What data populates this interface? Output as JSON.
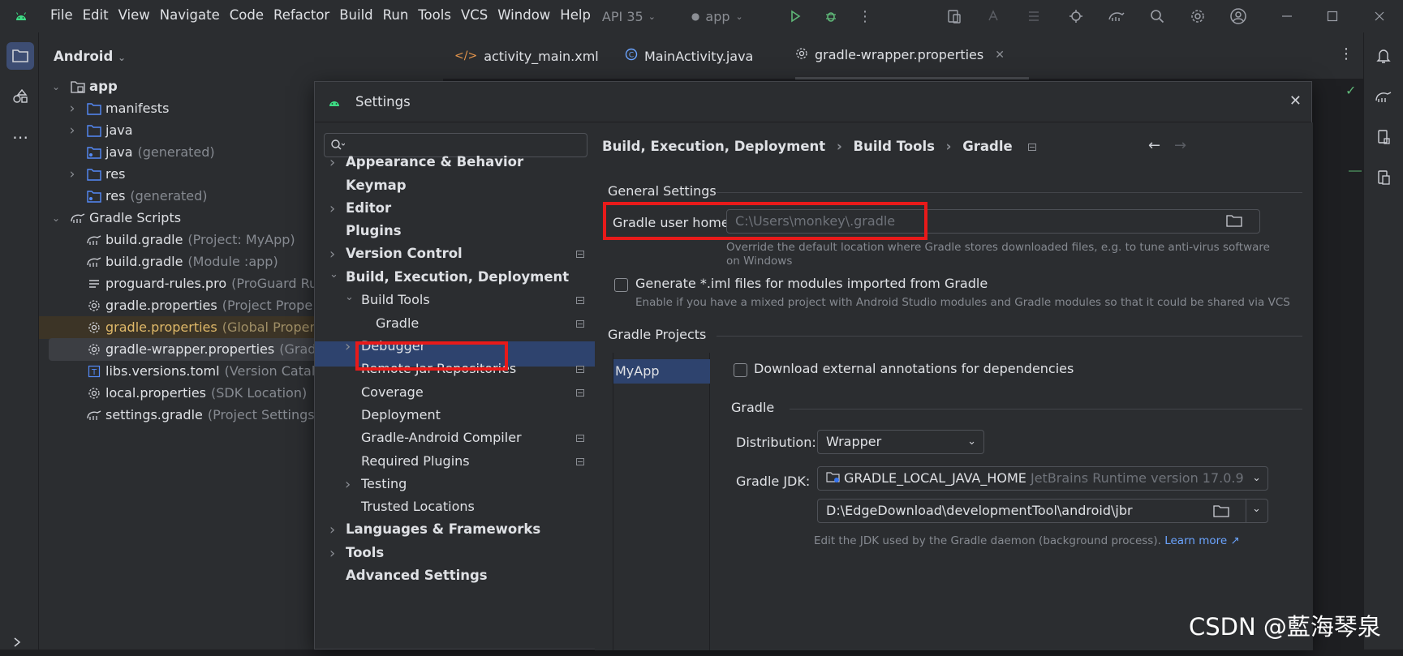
{
  "menu": [
    {
      "label": "File"
    },
    {
      "label": "Edit"
    },
    {
      "label": "View"
    },
    {
      "label": "Navigate"
    },
    {
      "label": "Code"
    },
    {
      "label": "Refactor"
    },
    {
      "label": "Build"
    },
    {
      "label": "Run"
    },
    {
      "label": "Tools"
    },
    {
      "label": "VCS"
    },
    {
      "label": "Window"
    },
    {
      "label": "Help"
    }
  ],
  "api_level": "API 35",
  "run_config": "app",
  "project_panel": {
    "title": "Android",
    "tree": [
      {
        "label": "app",
        "hint": ""
      },
      {
        "label": "manifests",
        "hint": ""
      },
      {
        "label": "java",
        "hint": ""
      },
      {
        "label": "java",
        "hint": "(generated)"
      },
      {
        "label": "res",
        "hint": ""
      },
      {
        "label": "res",
        "hint": "(generated)"
      },
      {
        "label": "Gradle Scripts",
        "hint": ""
      },
      {
        "label": "build.gradle",
        "hint": "(Project: MyApp)"
      },
      {
        "label": "build.gradle",
        "hint": "(Module :app)"
      },
      {
        "label": "proguard-rules.pro",
        "hint": "(ProGuard Ru"
      },
      {
        "label": "gradle.properties",
        "hint": "(Project Prope"
      },
      {
        "label": "gradle.properties",
        "hint": "(Global Proper"
      },
      {
        "label": "gradle-wrapper.properties",
        "hint": "(Grad"
      },
      {
        "label": "libs.versions.toml",
        "hint": "(Version Catal"
      },
      {
        "label": "local.properties",
        "hint": "(SDK Location)"
      },
      {
        "label": "settings.gradle",
        "hint": "(Project Settings"
      }
    ]
  },
  "tabs": [
    {
      "label": "activity_main.xml"
    },
    {
      "label": "MainActivity.java"
    },
    {
      "label": "gradle-wrapper.properties"
    }
  ],
  "settings": {
    "title": "Settings",
    "search_placeholder": "",
    "nav": [
      {
        "label": "Appearance & Behavior"
      },
      {
        "label": "Keymap"
      },
      {
        "label": "Editor"
      },
      {
        "label": "Plugins"
      },
      {
        "label": "Version Control"
      },
      {
        "label": "Build, Execution, Deployment"
      },
      {
        "label": "Build Tools"
      },
      {
        "label": "Gradle"
      },
      {
        "label": "Debugger"
      },
      {
        "label": "Remote Jar Repositories"
      },
      {
        "label": "Coverage"
      },
      {
        "label": "Deployment"
      },
      {
        "label": "Gradle-Android Compiler"
      },
      {
        "label": "Required Plugins"
      },
      {
        "label": "Testing"
      },
      {
        "label": "Trusted Locations"
      },
      {
        "label": "Languages & Frameworks"
      },
      {
        "label": "Tools"
      },
      {
        "label": "Advanced Settings"
      }
    ],
    "breadcrumb": [
      "Build, Execution, Deployment",
      "Build Tools",
      "Gradle"
    ],
    "general_settings": "General Settings",
    "gradle_user_home_label": "Gradle user home:",
    "gradle_user_home_value": "C:\\Users\\monkey\\.gradle",
    "gradle_user_home_desc_1": "Override the default location where Gradle stores downloaded files, e.g. to tune anti-virus software",
    "gradle_user_home_desc_2": "on Windows",
    "generate_iml_label": "Generate *.iml files for modules imported from Gradle",
    "generate_iml_desc": "Enable if you have a mixed project with Android Studio modules and Gradle modules so that it could be shared via VCS",
    "gradle_projects": "Gradle Projects",
    "project_item": "MyApp",
    "download_annotations": "Download external annotations for dependencies",
    "gradle_section": "Gradle",
    "distribution_label": "Distribution:",
    "distribution_value": "Wrapper",
    "gradle_jdk_label": "Gradle JDK:",
    "gradle_jdk_value": "GRADLE_LOCAL_JAVA_HOME",
    "gradle_jdk_hint": "JetBrains Runtime version 17.0.9",
    "jdk_path": "D:\\EdgeDownload\\developmentTool\\android\\jbr",
    "jdk_desc": "Edit the JDK used by the Gradle daemon (background process).",
    "learn_more": "Learn more ↗"
  },
  "watermark": "CSDN @藍海琴泉",
  "colors": {
    "accent": "#3574f0",
    "highlight": "#e81a1a",
    "selection": "#2e436e",
    "link": "#6ba4ff"
  }
}
